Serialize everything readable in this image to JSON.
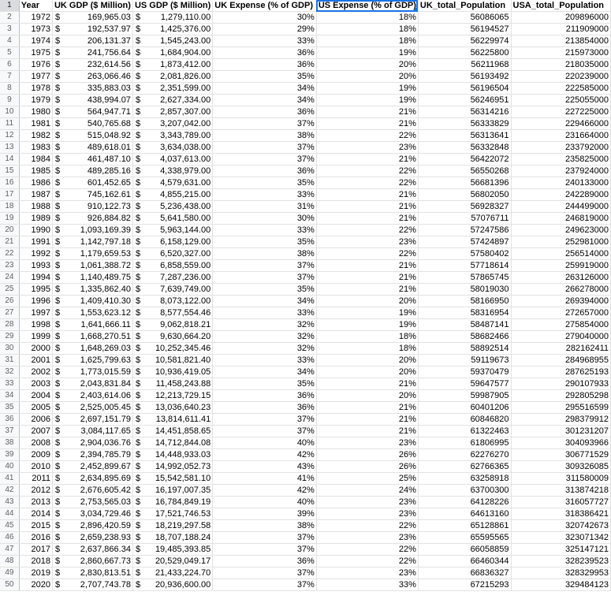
{
  "headers": {
    "year": "Year",
    "uk_gdp": "UK GDP ($ Million)",
    "us_gdp": "US GDP ($ Million)",
    "uk_expense": "UK Expense (% of GDP)",
    "us_expense": "US Expense (% of GDP)",
    "uk_pop": "UK_total_Population",
    "usa_pop": "USA_total_Population"
  },
  "currency_symbol": "$",
  "rows": [
    [
      "1972",
      "169,965.03",
      "1,279,110.00",
      "30%",
      "18%",
      "56086065",
      "209896000"
    ],
    [
      "1973",
      "192,537.97",
      "1,425,376.00",
      "29%",
      "18%",
      "56194527",
      "211909000"
    ],
    [
      "1974",
      "206,131.37",
      "1,545,243.00",
      "33%",
      "18%",
      "56229974",
      "213854000"
    ],
    [
      "1975",
      "241,756.64",
      "1,684,904.00",
      "36%",
      "19%",
      "56225800",
      "215973000"
    ],
    [
      "1976",
      "232,614.56",
      "1,873,412.00",
      "36%",
      "20%",
      "56211968",
      "218035000"
    ],
    [
      "1977",
      "263,066.46",
      "2,081,826.00",
      "35%",
      "20%",
      "56193492",
      "220239000"
    ],
    [
      "1978",
      "335,883.03",
      "2,351,599.00",
      "34%",
      "19%",
      "56196504",
      "222585000"
    ],
    [
      "1979",
      "438,994.07",
      "2,627,334.00",
      "34%",
      "19%",
      "56246951",
      "225055000"
    ],
    [
      "1980",
      "564,947.71",
      "2,857,307.00",
      "36%",
      "21%",
      "56314216",
      "227225000"
    ],
    [
      "1981",
      "540,765.68",
      "3,207,042.00",
      "37%",
      "21%",
      "56333829",
      "229466000"
    ],
    [
      "1982",
      "515,048.92",
      "3,343,789.00",
      "38%",
      "22%",
      "56313641",
      "231664000"
    ],
    [
      "1983",
      "489,618.01",
      "3,634,038.00",
      "37%",
      "23%",
      "56332848",
      "233792000"
    ],
    [
      "1984",
      "461,487.10",
      "4,037,613.00",
      "37%",
      "21%",
      "56422072",
      "235825000"
    ],
    [
      "1985",
      "489,285.16",
      "4,338,979.00",
      "36%",
      "22%",
      "56550268",
      "237924000"
    ],
    [
      "1986",
      "601,452.65",
      "4,579,631.00",
      "35%",
      "22%",
      "56681396",
      "240133000"
    ],
    [
      "1987",
      "745,162.61",
      "4,855,215.00",
      "33%",
      "21%",
      "56802050",
      "242289000"
    ],
    [
      "1988",
      "910,122.73",
      "5,236,438.00",
      "31%",
      "21%",
      "56928327",
      "244499000"
    ],
    [
      "1989",
      "926,884.82",
      "5,641,580.00",
      "30%",
      "21%",
      "57076711",
      "246819000"
    ],
    [
      "1990",
      "1,093,169.39",
      "5,963,144.00",
      "33%",
      "22%",
      "57247586",
      "249623000"
    ],
    [
      "1991",
      "1,142,797.18",
      "6,158,129.00",
      "35%",
      "23%",
      "57424897",
      "252981000"
    ],
    [
      "1992",
      "1,179,659.53",
      "6,520,327.00",
      "38%",
      "22%",
      "57580402",
      "256514000"
    ],
    [
      "1993",
      "1,061,388.72",
      "6,858,559.00",
      "37%",
      "21%",
      "57718614",
      "259919000"
    ],
    [
      "1994",
      "1,140,489.75",
      "7,287,236.00",
      "37%",
      "21%",
      "57865745",
      "263126000"
    ],
    [
      "1995",
      "1,335,862.40",
      "7,639,749.00",
      "35%",
      "21%",
      "58019030",
      "266278000"
    ],
    [
      "1996",
      "1,409,410.30",
      "8,073,122.00",
      "34%",
      "20%",
      "58166950",
      "269394000"
    ],
    [
      "1997",
      "1,553,623.12",
      "8,577,554.46",
      "33%",
      "19%",
      "58316954",
      "272657000"
    ],
    [
      "1998",
      "1,641,666.11",
      "9,062,818.21",
      "32%",
      "19%",
      "58487141",
      "275854000"
    ],
    [
      "1999",
      "1,668,270.51",
      "9,630,664.20",
      "32%",
      "18%",
      "58682466",
      "279040000"
    ],
    [
      "2000",
      "1,648,269.03",
      "10,252,345.46",
      "32%",
      "18%",
      "58892514",
      "282162411"
    ],
    [
      "2001",
      "1,625,799.63",
      "10,581,821.40",
      "33%",
      "20%",
      "59119673",
      "284968955"
    ],
    [
      "2002",
      "1,773,015.59",
      "10,936,419.05",
      "34%",
      "20%",
      "59370479",
      "287625193"
    ],
    [
      "2003",
      "2,043,831.84",
      "11,458,243.88",
      "35%",
      "21%",
      "59647577",
      "290107933"
    ],
    [
      "2004",
      "2,403,614.06",
      "12,213,729.15",
      "36%",
      "20%",
      "59987905",
      "292805298"
    ],
    [
      "2005",
      "2,525,005.45",
      "13,036,640.23",
      "36%",
      "21%",
      "60401206",
      "295516599"
    ],
    [
      "2006",
      "2,697,151.79",
      "13,814,611.41",
      "37%",
      "21%",
      "60846820",
      "298379912"
    ],
    [
      "2007",
      "3,084,117.65",
      "14,451,858.65",
      "37%",
      "21%",
      "61322463",
      "301231207"
    ],
    [
      "2008",
      "2,904,036.76",
      "14,712,844.08",
      "40%",
      "23%",
      "61806995",
      "304093966"
    ],
    [
      "2009",
      "2,394,785.79",
      "14,448,933.03",
      "42%",
      "26%",
      "62276270",
      "306771529"
    ],
    [
      "2010",
      "2,452,899.67",
      "14,992,052.73",
      "43%",
      "26%",
      "62766365",
      "309326085"
    ],
    [
      "2011",
      "2,634,895.69",
      "15,542,581.10",
      "41%",
      "25%",
      "63258918",
      "311580009"
    ],
    [
      "2012",
      "2,676,605.42",
      "16,197,007.35",
      "42%",
      "24%",
      "63700300",
      "313874218"
    ],
    [
      "2013",
      "2,753,565.03",
      "16,784,849.19",
      "40%",
      "23%",
      "64128226",
      "316057727"
    ],
    [
      "2014",
      "3,034,729.46",
      "17,521,746.53",
      "39%",
      "23%",
      "64613160",
      "318386421"
    ],
    [
      "2015",
      "2,896,420.59",
      "18,219,297.58",
      "38%",
      "22%",
      "65128861",
      "320742673"
    ],
    [
      "2016",
      "2,659,238.93",
      "18,707,188.24",
      "37%",
      "23%",
      "65595565",
      "323071342"
    ],
    [
      "2017",
      "2,637,866.34",
      "19,485,393.85",
      "37%",
      "22%",
      "66058859",
      "325147121"
    ],
    [
      "2018",
      "2,860,667.73",
      "20,529,049.17",
      "36%",
      "22%",
      "66460344",
      "328239523"
    ],
    [
      "2019",
      "2,830,813.51",
      "21,433,224.70",
      "37%",
      "23%",
      "66836327",
      "328329953"
    ],
    [
      "2020",
      "2,707,743.78",
      "20,936,600.00",
      "37%",
      "33%",
      "67215293",
      "329484123"
    ]
  ]
}
